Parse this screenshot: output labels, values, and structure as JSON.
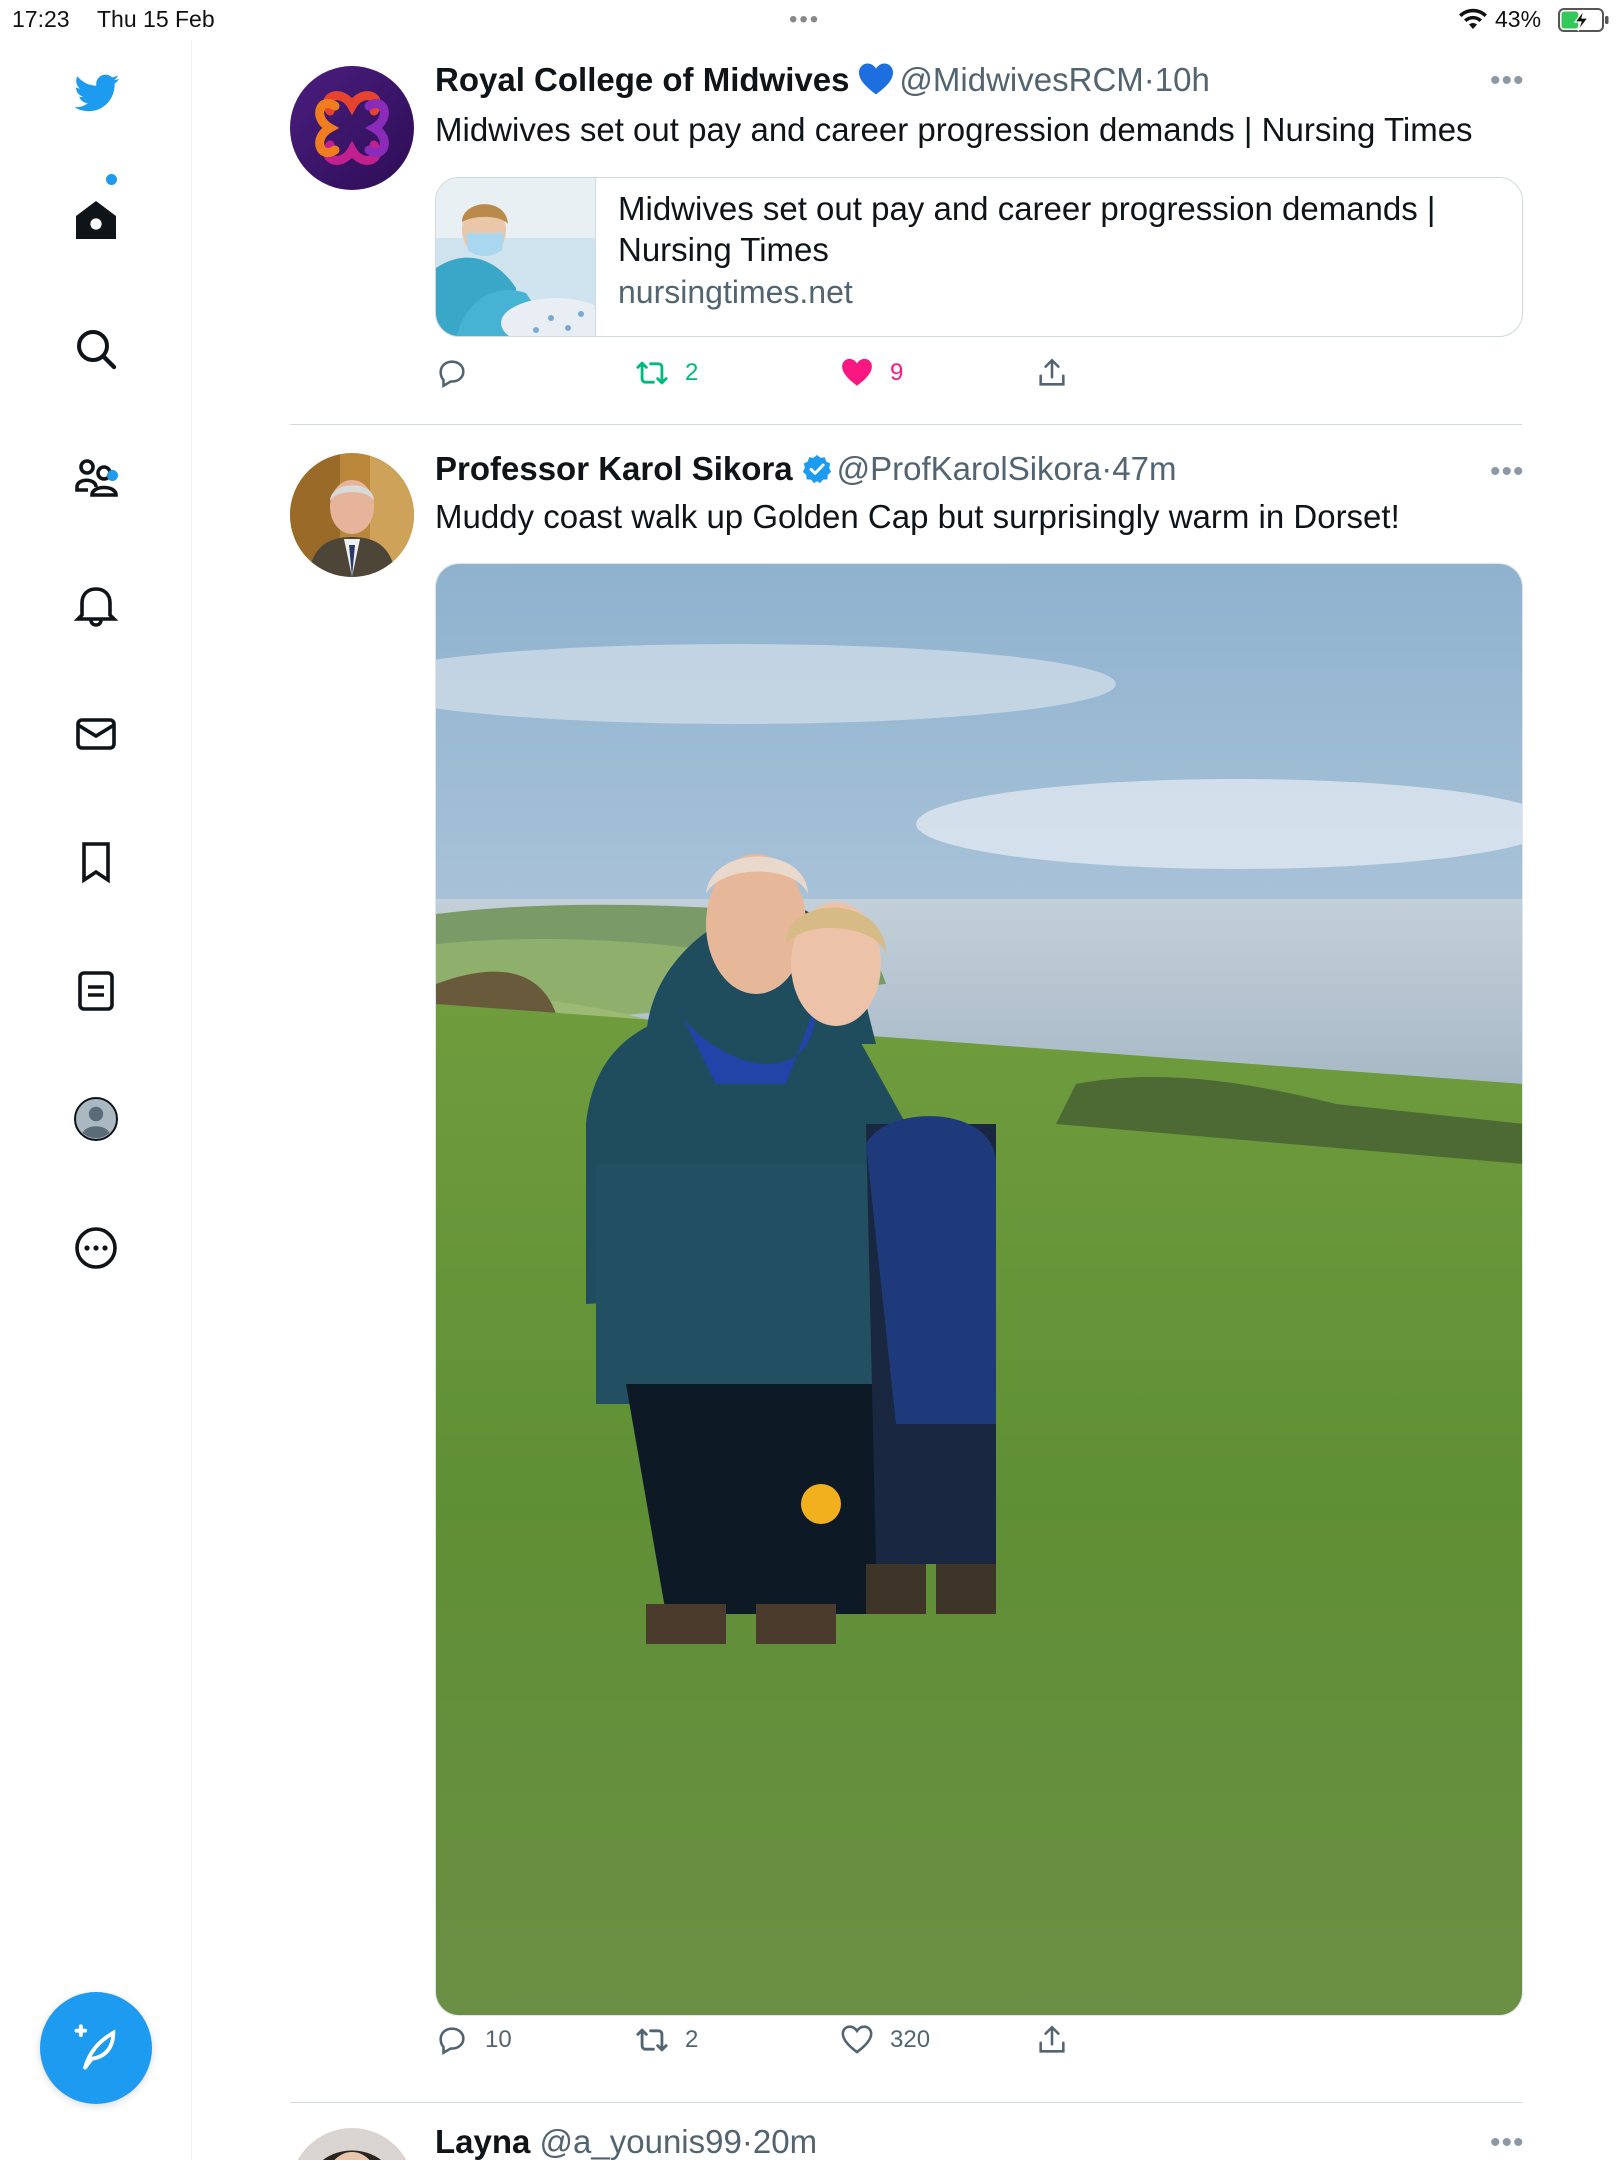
{
  "status_bar": {
    "time": "17:23",
    "date": "Thu 15 Feb",
    "battery_percent": "43%",
    "battery_level": 0.43,
    "charging": true
  },
  "sidebar": {
    "items": [
      {
        "id": "logo",
        "icon": "twitter-bird-icon"
      },
      {
        "id": "home",
        "icon": "home-icon",
        "has_dot": true
      },
      {
        "id": "search",
        "icon": "search-icon"
      },
      {
        "id": "communities",
        "icon": "communities-icon",
        "has_dot": true
      },
      {
        "id": "notifications",
        "icon": "bell-icon"
      },
      {
        "id": "messages",
        "icon": "mail-icon"
      },
      {
        "id": "bookmarks",
        "icon": "bookmark-icon"
      },
      {
        "id": "lists",
        "icon": "lists-icon"
      },
      {
        "id": "profile",
        "icon": "profile-avatar-icon"
      },
      {
        "id": "more",
        "icon": "more-circle-icon"
      }
    ],
    "compose_icon": "compose-tweet-icon",
    "accent_color": "#1d9bf0"
  },
  "tweets": [
    {
      "name": "Royal College of Midwives",
      "badge": "blue-heart",
      "handle": "@MidwivesRCM",
      "separator": "·",
      "time": "10h",
      "text": "Midwives set out pay and career progression demands | Nursing Times",
      "card": {
        "title": "Midwives set out pay and career progression demands | Nursing Times",
        "domain": "nursingtimes.net"
      },
      "stats": {
        "replies": "",
        "retweets": "2",
        "likes": "9"
      },
      "liked": true
    },
    {
      "name": "Professor Karol Sikora",
      "badge": "verified",
      "handle": "@ProfKarolSikora",
      "separator": "·",
      "time": "47m",
      "text": "Muddy coast walk up Golden Cap but surprisingly warm in Dorset!",
      "stats": {
        "replies": "10",
        "retweets": "2",
        "likes": "320"
      },
      "liked": false
    },
    {
      "name": "Layna",
      "handle": "@a_younis99",
      "separator": "·",
      "time": "20m"
    }
  ],
  "colors": {
    "retweet_green": "#00ba7c",
    "like_pink": "#f91880",
    "secondary_text": "#536471"
  }
}
